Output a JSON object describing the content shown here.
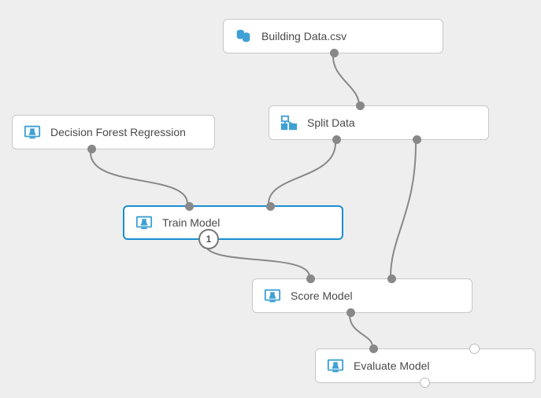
{
  "nodes": {
    "building_data": {
      "label": "Building Data.csv"
    },
    "decision_forest": {
      "label": "Decision Forest Regression"
    },
    "split_data": {
      "label": "Split Data"
    },
    "train_model": {
      "label": "Train Model"
    },
    "score_model": {
      "label": "Score Model"
    },
    "evaluate_model": {
      "label": "Evaluate Model"
    }
  },
  "badge": {
    "train_model": "1"
  },
  "colors": {
    "accent": "#1a8fd1",
    "icon": "#3ea0d4",
    "port": "#888888"
  }
}
